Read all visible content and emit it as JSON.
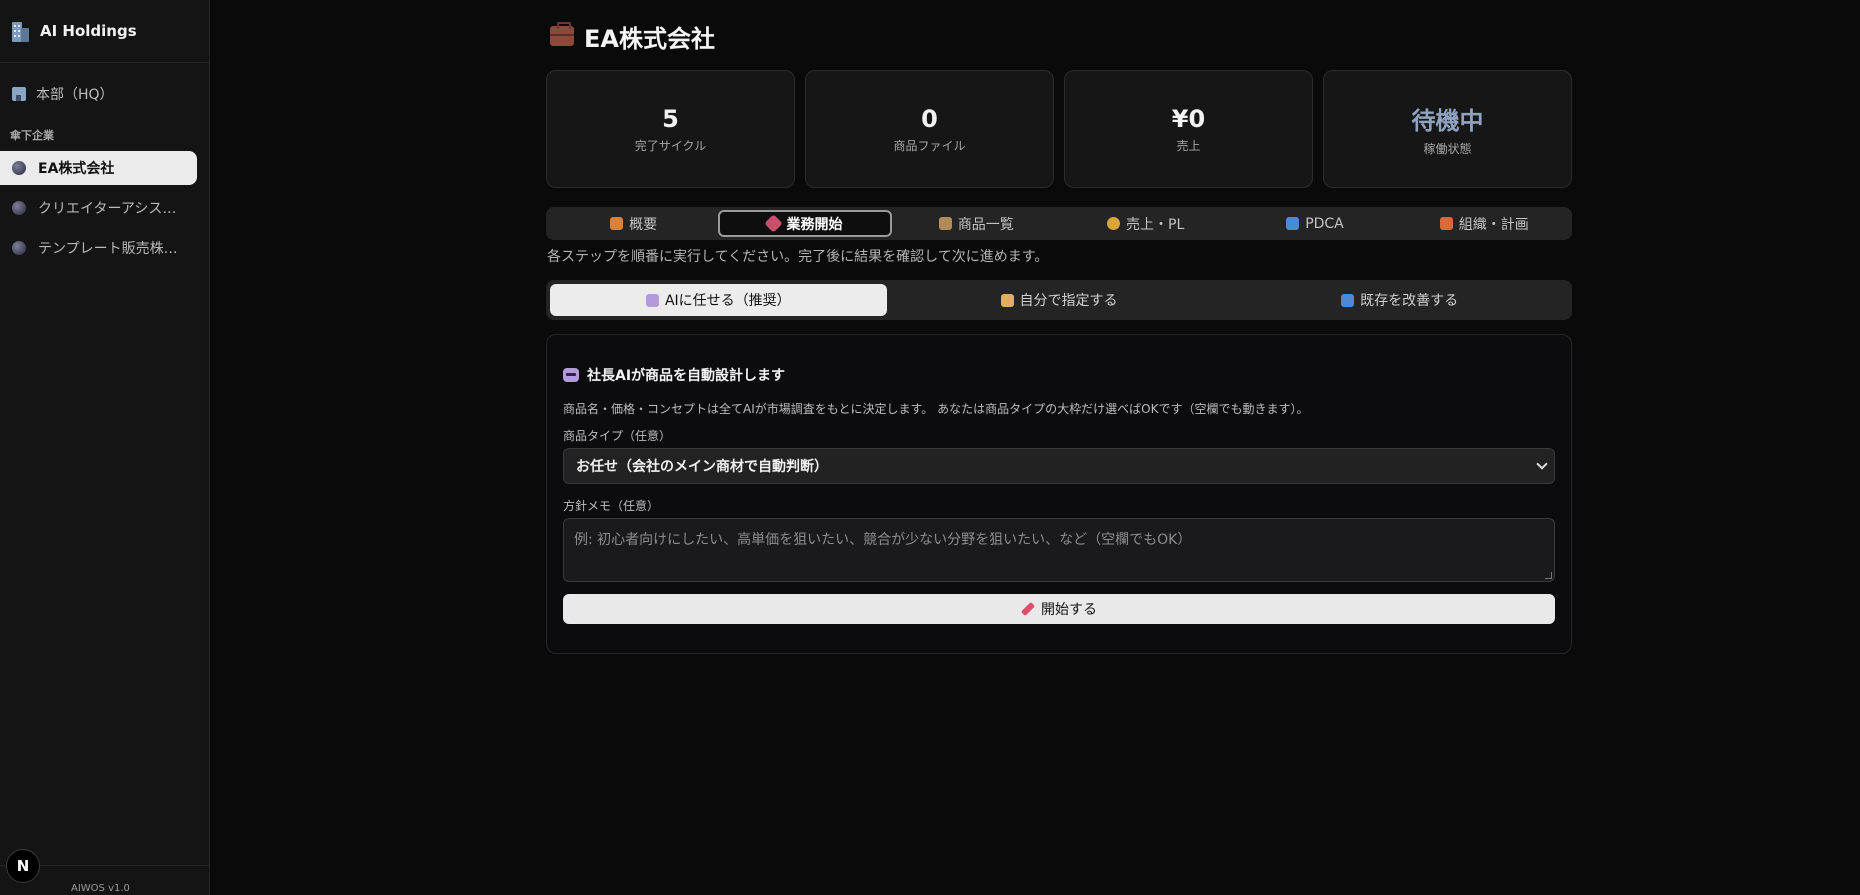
{
  "sidebar": {
    "brand": "AI Holdings",
    "hq_label": "本部（HQ）",
    "section_label": "傘下企業",
    "companies": [
      {
        "label": "EA株式会社",
        "active": true
      },
      {
        "label": "クリエイターアシス…",
        "active": false
      },
      {
        "label": "テンプレート販売株…",
        "active": false
      }
    ],
    "footer_badge": "N",
    "version": "AIWOS v1.0"
  },
  "header": {
    "title": "EA株式会社",
    "icon": "briefcase-icon"
  },
  "stats": [
    {
      "value": "5",
      "caption": "完了サイクル"
    },
    {
      "value": "0",
      "caption": "商品ファイル"
    },
    {
      "value": "¥0",
      "caption": "売上"
    },
    {
      "value": "待機中",
      "caption": "稼働状態"
    }
  ],
  "tabs": [
    {
      "label": "概要",
      "icon": "house-icon",
      "color": "#d9823b"
    },
    {
      "label": "業務開始",
      "icon": "rocket-icon",
      "color": "#c94f6a"
    },
    {
      "label": "商品一覧",
      "icon": "clipboard-icon",
      "color": "#b08a5a"
    },
    {
      "label": "売上・PL",
      "icon": "money-bag-icon",
      "color": "#d9a43b"
    },
    {
      "label": "PDCA",
      "icon": "cycle-icon",
      "color": "#4a8ad9"
    },
    {
      "label": "組織・計画",
      "icon": "construction-icon",
      "color": "#d96a3b"
    }
  ],
  "active_tab": "業務開始",
  "instructions": "各ステップを順番に実行してください。完了後に結果を確認して次に進めます。",
  "modes": [
    {
      "label": "AIに任せる（推奨）",
      "icon": "robot-icon",
      "color": "#b49ad8"
    },
    {
      "label": "自分で指定する",
      "icon": "writing-hand-icon",
      "color": "#e0b060"
    },
    {
      "label": "既存を改善する",
      "icon": "cycle-icon",
      "color": "#4a8ad9"
    }
  ],
  "panel": {
    "title": "社長AIが商品を自動設計します",
    "description": "商品名・価格・コンセプトは全てAIが市場調査をもとに決定します。 あなたは商品タイプの大枠だけ選べばOKです（空欄でも動きます）。",
    "type_label": "商品タイプ（任意）",
    "type_value": "お任せ（会社のメイン商材で自動判断）",
    "memo_label": "方針メモ（任意）",
    "memo_placeholder": "例: 初心者向けにしたい、高単価を狙いたい、競合が少ない分野を狙いたい、など（空欄でもOK）",
    "start_label": "開始する"
  }
}
